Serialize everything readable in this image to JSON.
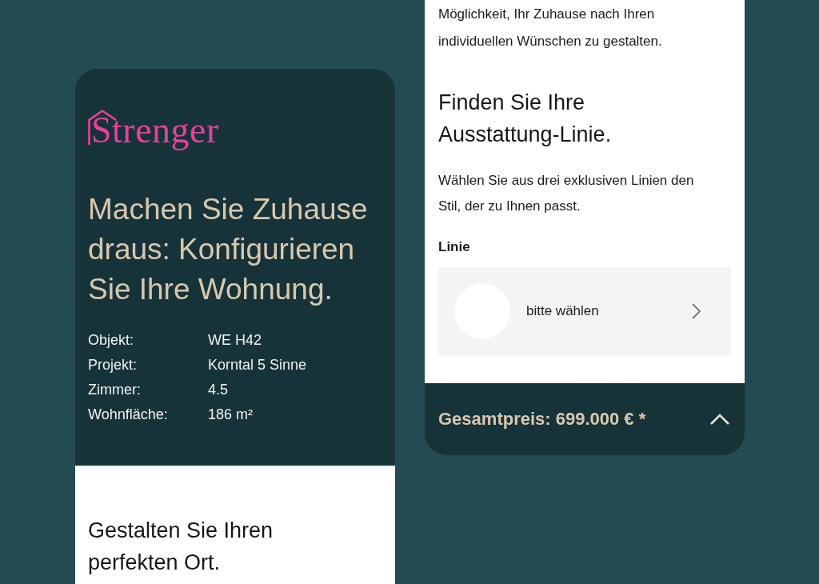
{
  "intro_card": {
    "brand": "Strenger",
    "heading": "Machen Sie Zuhause draus: Konfigurieren Sie Ihre Wohnung.",
    "details": [
      {
        "label": "Objekt:",
        "value": "WE H42"
      },
      {
        "label": "Projekt:",
        "value": "Korntal 5 Sinne"
      },
      {
        "label": "Zimmer:",
        "value": "4.5"
      },
      {
        "label": "Wohnfläche:",
        "value": "186 m²"
      }
    ],
    "section_heading": "Gestalten Sie Ihren perfekten Ort."
  },
  "configurator_card": {
    "intro_text": "Möglichkeit, Ihr Zuhause nach Ihren individuellen Wünschen zu gestalten.",
    "heading": "Finden Sie Ihre Ausstattung-Linie.",
    "description": "Wählen Sie aus drei exklusiven Linien den Stil, der zu Ihnen passt.",
    "field_label": "Linie",
    "select": {
      "placeholder": "bitte wählen"
    },
    "total_price": "Gesamtpreis: 699.000 € *",
    "expanded": false
  }
}
